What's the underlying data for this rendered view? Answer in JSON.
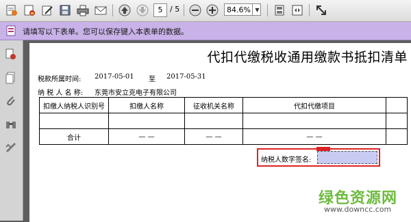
{
  "toolbar": {
    "page_current": "5",
    "page_total": "/ 5",
    "zoom": "84.6%",
    "icons": [
      "edit-document-icon",
      "secure-document-icon",
      "sign-icon",
      "save-icon",
      "print-icon",
      "email-icon",
      "page-up-icon",
      "page-down-icon",
      "zoom-out-icon",
      "zoom-in-icon",
      "fit-page-icon",
      "fit-width-icon",
      "fullscreen-icon"
    ]
  },
  "formbar": {
    "message": "请填写以下表单。您可以保存键入本表单的数据。"
  },
  "document": {
    "title": "代扣代缴税收通用缴款书抵扣清单",
    "period_label": "税款所属时间:",
    "period_from": "2017-05-01",
    "period_to_label": "至",
    "period_to": "2017-05-31",
    "taxpayer_label": "纳 税 人 名 称:",
    "taxpayer_name": "东莞市安立克电子有限公司",
    "table": {
      "headers": [
        "扣缴人纳税人识别号",
        "扣缴人名称",
        "征收机关名称",
        "代扣代缴项目",
        ""
      ],
      "total_row": [
        "合计",
        "— —",
        "— —",
        "— —",
        ""
      ]
    },
    "signature_label": "纳税人数字签名:"
  },
  "watermark": {
    "main": "绿色资源网",
    "sub": "www.downcc.com"
  },
  "colors": {
    "formbar": "#c9b2e8",
    "signature_border": "#dd2222",
    "signature_field": "#c8cbf2",
    "watermark": "#6dbb3f"
  }
}
